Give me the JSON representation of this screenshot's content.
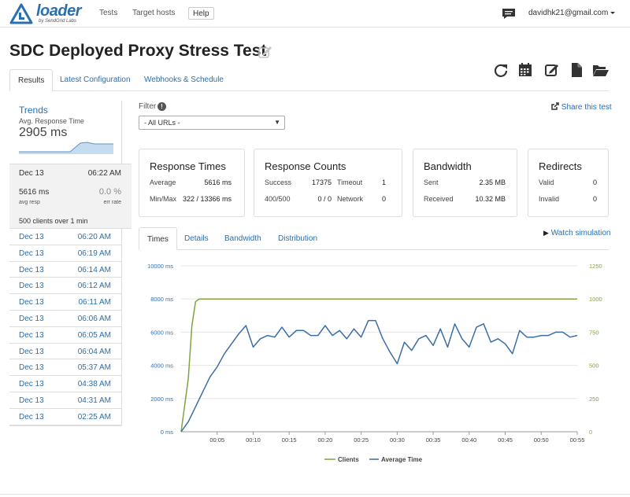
{
  "nav": {
    "logo_text": "loader",
    "logo_sub": "by SendGrid Labs",
    "links": [
      "Tests",
      "Target hosts"
    ],
    "help": "Help",
    "user_email": "davidhk21@gmail.com"
  },
  "page": {
    "title": "SDC Deployed Proxy Stress Test",
    "toolbar_icons": [
      "refresh-icon",
      "calendar-icon",
      "edit-icon",
      "document-icon",
      "folder-open-icon"
    ]
  },
  "tabs": [
    "Results",
    "Latest Configuration",
    "Webhooks & Schedule"
  ],
  "sidebar": {
    "trends_title": "Trends",
    "trends_sub": "Avg. Response Time",
    "trends_value": "2905 ms",
    "selected": {
      "date": "Dec 13",
      "time": "06:22 AM",
      "avg_resp": "5616 ms",
      "avg_resp_label": "avg resp",
      "err_rate": "0.0 %",
      "err_rate_label": "err rate",
      "clients": "500 clients over 1 min"
    },
    "history": [
      {
        "date": "Dec 13",
        "time": "06:20 AM"
      },
      {
        "date": "Dec 13",
        "time": "06:19 AM"
      },
      {
        "date": "Dec 13",
        "time": "06:14 AM"
      },
      {
        "date": "Dec 13",
        "time": "06:12 AM"
      },
      {
        "date": "Dec 13",
        "time": "06:11 AM"
      },
      {
        "date": "Dec 13",
        "time": "06:06 AM"
      },
      {
        "date": "Dec 13",
        "time": "06:05 AM"
      },
      {
        "date": "Dec 13",
        "time": "06:04 AM"
      },
      {
        "date": "Dec 13",
        "time": "05:37 AM"
      },
      {
        "date": "Dec 13",
        "time": "04:38 AM"
      },
      {
        "date": "Dec 13",
        "time": "04:31 AM"
      },
      {
        "date": "Dec 13",
        "time": "02:25 AM"
      }
    ]
  },
  "filter": {
    "label": "Filter",
    "info": "!",
    "selected": "- All URLs -",
    "share": "Share this test"
  },
  "panels": {
    "response_times": {
      "title": "Response Times",
      "average_label": "Average",
      "average": "5616 ms",
      "minmax_label": "Min/Max",
      "minmax": "322 / 13366 ms"
    },
    "response_counts": {
      "title": "Response Counts",
      "success_label": "Success",
      "success": "17375",
      "timeout_label": "Timeout",
      "timeout": "1",
      "err_label": "400/500",
      "err": "0 / 0",
      "network_label": "Network",
      "network": "0"
    },
    "bandwidth": {
      "title": "Bandwidth",
      "sent_label": "Sent",
      "sent": "2.35 MB",
      "received_label": "Received",
      "received": "10.32 MB"
    },
    "redirects": {
      "title": "Redirects",
      "valid_label": "Valid",
      "valid": "0",
      "invalid_label": "Invalid",
      "invalid": "0"
    }
  },
  "chart_tabs": [
    "Times",
    "Details",
    "Bandwidth",
    "Distribution"
  ],
  "watch": "Watch simulation",
  "colors": {
    "link": "#2a6fae",
    "clients": "#7ea53f",
    "avg_time": "#3b6ea5"
  },
  "chart_data": {
    "type": "line",
    "x_ticks": [
      "00:05",
      "00:10",
      "00:15",
      "00:20",
      "00:25",
      "00:30",
      "00:35",
      "00:40",
      "00:45",
      "00:50",
      "00:55"
    ],
    "y_left_ticks": [
      "0 ms",
      "2000 ms",
      "4000 ms",
      "6000 ms",
      "8000 ms",
      "10000 ms"
    ],
    "y_right_ticks": [
      "0",
      "250",
      "500",
      "750",
      "1000",
      "1250"
    ],
    "ylim_left": [
      0,
      10000
    ],
    "ylim_right": [
      0,
      1250
    ],
    "xlim_seconds": [
      0,
      55
    ],
    "legend": [
      "Clients",
      "Average Time"
    ],
    "series": [
      {
        "name": "Clients",
        "axis": "right",
        "x": [
          0,
          1,
          1.5,
          2,
          2.5,
          3,
          10,
          20,
          30,
          40,
          50,
          55
        ],
        "y": [
          0,
          400,
          800,
          980,
          1000,
          1000,
          1000,
          1000,
          1000,
          1000,
          1000,
          1000
        ]
      },
      {
        "name": "Average Time",
        "axis": "left",
        "x": [
          0,
          1,
          2,
          3,
          4,
          5,
          6,
          7,
          8,
          9,
          10,
          11,
          12,
          13,
          14,
          15,
          16,
          17,
          18,
          19,
          20,
          21,
          22,
          23,
          24,
          25,
          26,
          27,
          28,
          29,
          30,
          31,
          32,
          33,
          34,
          35,
          36,
          37,
          38,
          39,
          40,
          41,
          42,
          43,
          44,
          45,
          46,
          47,
          48,
          49,
          50,
          51,
          52,
          53,
          54,
          55
        ],
        "y": [
          0,
          600,
          1500,
          2400,
          3300,
          3900,
          4700,
          5300,
          5900,
          6400,
          5100,
          5600,
          5800,
          5700,
          6300,
          5700,
          6100,
          6100,
          5800,
          5800,
          6400,
          5800,
          6100,
          5600,
          6200,
          5700,
          6700,
          6700,
          5600,
          4800,
          4100,
          5400,
          4900,
          5600,
          5800,
          5200,
          6200,
          5100,
          6500,
          5600,
          5100,
          6300,
          6500,
          5400,
          5600,
          5300,
          4700,
          6100,
          5700,
          5700,
          5800,
          5800,
          6000,
          6000,
          5700,
          5800
        ]
      }
    ]
  }
}
